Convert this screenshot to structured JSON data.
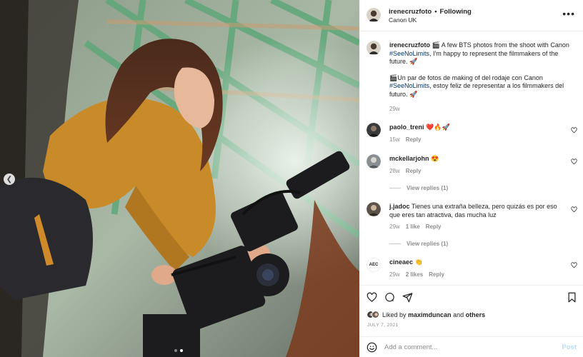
{
  "post": {
    "image_alt": "Woman operating a Canon cinema camera under a green steel roof structure",
    "carousel": {
      "current": 2,
      "total": 2
    }
  },
  "header": {
    "username": "irenecruzfoto",
    "separator": "•",
    "follow_label": "Following",
    "location": "Canon UK",
    "more_icon": "more-horizontal-icon"
  },
  "caption": {
    "username": "irenecruzfoto",
    "line1_pre": "🎬 A few BTS photos from the shoot with Canon ",
    "hashtag1": "#SeeNoLimits",
    "line1_post": ", I'm happy to represent the filmmakers of the future. 🚀",
    "line2_pre": "🎬Un par de fotos de making of del rodaje con Canon ",
    "hashtag2": "#SeeNoLimits",
    "line2_post": ", estoy feliz de representar a los filmmakers del futuro. 🚀",
    "time": "29w"
  },
  "comments": [
    {
      "username": "paolo_treni",
      "text": "❤️🔥🚀",
      "time": "15w",
      "likes": "",
      "reply": "Reply",
      "view_replies": ""
    },
    {
      "username": "mckellarjohn",
      "text": "😍",
      "time": "28w",
      "likes": "",
      "reply": "Reply",
      "view_replies": "View replies (1)"
    },
    {
      "username": "j.jadoc",
      "text": "Tienes una extraña belleza, pero quizás es por eso que eres tan atractiva, das mucha luz",
      "time": "29w",
      "likes": "1 like",
      "reply": "Reply",
      "view_replies": "View replies (1)"
    },
    {
      "username": "cineaec",
      "text": "👏",
      "time": "29w",
      "likes": "2 likes",
      "reply": "Reply",
      "view_replies": ""
    }
  ],
  "cineaec_avatar_text": "AEC",
  "likes": {
    "prefix": "Liked by ",
    "user": "maximduncan",
    "middle": " and ",
    "others": "others"
  },
  "date": "JULY 7, 2021",
  "add_comment": {
    "placeholder": "Add a comment...",
    "post_label": "Post"
  },
  "icons": {
    "like": "heart-icon",
    "comment": "comment-icon",
    "share": "share-icon",
    "save": "bookmark-icon",
    "emoji": "emoji-icon",
    "prev": "chevron-left-icon"
  },
  "colors": {
    "hashtag": "#00376b",
    "secondary": "#8e8e8e",
    "post_disabled": "#b2dffc"
  }
}
